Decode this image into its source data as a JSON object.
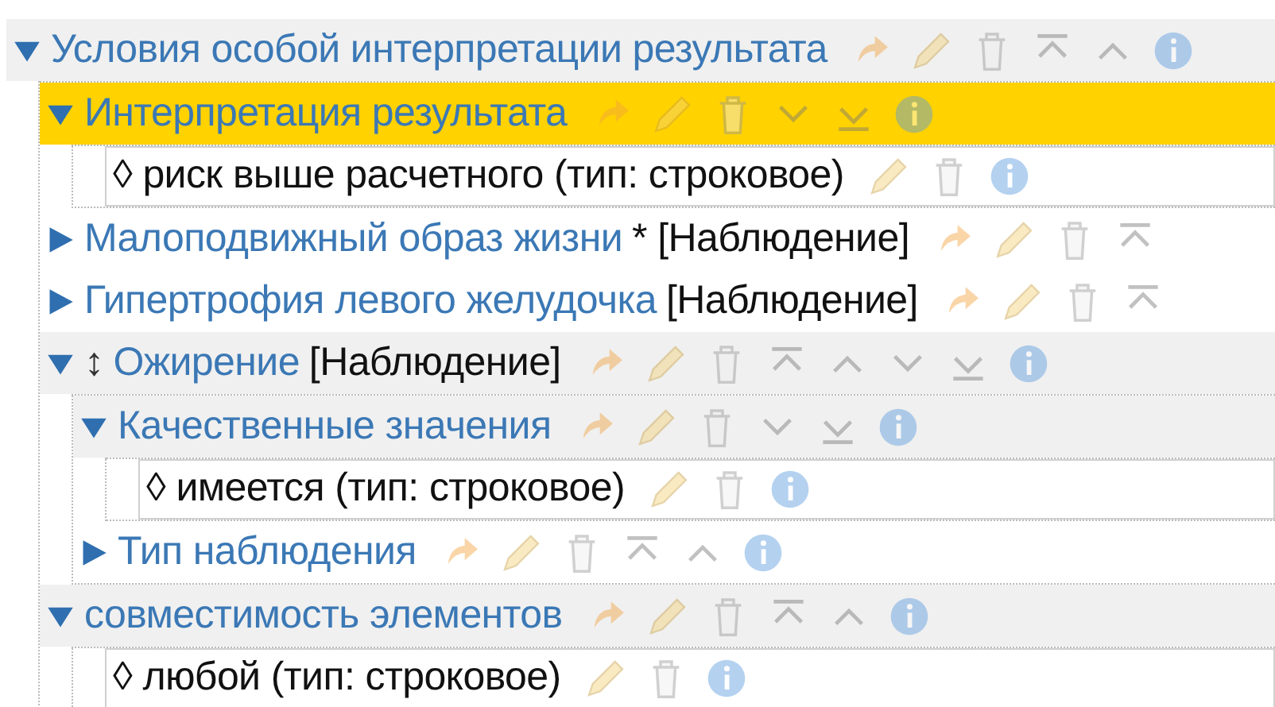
{
  "tree": [
    {
      "kind": "group",
      "label": "Условия особой интерпретации результата",
      "expanded": true,
      "selected": false,
      "actions": [
        {
          "kind": "copy"
        },
        {
          "kind": "edit"
        },
        {
          "kind": "delete"
        },
        {
          "kind": "top"
        },
        {
          "kind": "up"
        },
        {
          "kind": "info"
        }
      ],
      "children": [
        {
          "kind": "group",
          "label": "Интерпретация результата",
          "expanded": true,
          "selected": true,
          "actions": [
            {
              "kind": "copy"
            },
            {
              "kind": "edit"
            },
            {
              "kind": "delete"
            },
            {
              "kind": "down"
            },
            {
              "kind": "bottom"
            },
            {
              "kind": "info"
            }
          ],
          "children": [
            {
              "kind": "leaf",
              "label": "◊ риск выше расчетного (тип: строковое)",
              "actions": [
                {
                  "kind": "edit"
                },
                {
                  "kind": "delete"
                },
                {
                  "kind": "info"
                }
              ]
            }
          ]
        },
        {
          "kind": "group",
          "label": "Малоподвижный образ жизни",
          "suffix": "* [Наблюдение]",
          "expanded": false,
          "selected": false,
          "actions": [
            {
              "kind": "copy"
            },
            {
              "kind": "edit"
            },
            {
              "kind": "delete"
            },
            {
              "kind": "top"
            }
          ]
        },
        {
          "kind": "group",
          "label": "Гипертрофия левого желудочка",
          "suffix": "[Наблюдение]",
          "expanded": false,
          "selected": false,
          "actions": [
            {
              "kind": "copy"
            },
            {
              "kind": "edit"
            },
            {
              "kind": "delete"
            },
            {
              "kind": "top"
            }
          ]
        },
        {
          "kind": "group",
          "label": "Ожирение",
          "handle": "↕",
          "suffix": "[Наблюдение]",
          "expanded": true,
          "selected": false,
          "actions": [
            {
              "kind": "copy"
            },
            {
              "kind": "edit"
            },
            {
              "kind": "delete"
            },
            {
              "kind": "top"
            },
            {
              "kind": "up"
            },
            {
              "kind": "down"
            },
            {
              "kind": "bottom"
            },
            {
              "kind": "info"
            }
          ],
          "children": [
            {
              "kind": "group",
              "label": "Качественные значения",
              "expanded": true,
              "selected": false,
              "actions": [
                {
                  "kind": "copy"
                },
                {
                  "kind": "edit"
                },
                {
                  "kind": "delete"
                },
                {
                  "kind": "down"
                },
                {
                  "kind": "bottom"
                },
                {
                  "kind": "info"
                }
              ],
              "children": [
                {
                  "kind": "leaf",
                  "label": "◊ имеется (тип: строковое)",
                  "actions": [
                    {
                      "kind": "edit"
                    },
                    {
                      "kind": "delete"
                    },
                    {
                      "kind": "info"
                    }
                  ]
                }
              ]
            },
            {
              "kind": "group",
              "label": "Тип наблюдения",
              "expanded": false,
              "selected": false,
              "actions": [
                {
                  "kind": "copy"
                },
                {
                  "kind": "edit"
                },
                {
                  "kind": "delete"
                },
                {
                  "kind": "top"
                },
                {
                  "kind": "up"
                },
                {
                  "kind": "info"
                }
              ]
            }
          ]
        },
        {
          "kind": "group",
          "label": "совместимость элементов",
          "expanded": true,
          "selected": false,
          "actions": [
            {
              "kind": "copy"
            },
            {
              "kind": "edit"
            },
            {
              "kind": "delete"
            },
            {
              "kind": "top"
            },
            {
              "kind": "up"
            },
            {
              "kind": "info"
            }
          ],
          "children": [
            {
              "kind": "leaf",
              "label": "◊ любой (тип: строковое)",
              "actions": [
                {
                  "kind": "edit"
                },
                {
                  "kind": "delete"
                },
                {
                  "kind": "info"
                }
              ]
            }
          ]
        }
      ]
    }
  ]
}
